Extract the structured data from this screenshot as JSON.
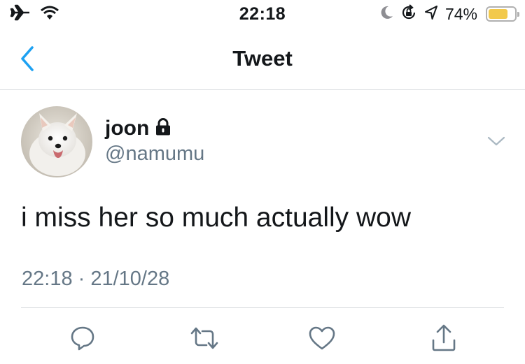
{
  "status_bar": {
    "time": "22:18",
    "battery_percent_label": "74%",
    "battery_level": 0.74,
    "icons": [
      "airplane-mode-icon",
      "wifi-icon",
      "do-not-disturb-moon-icon",
      "orientation-lock-icon",
      "location-arrow-icon",
      "battery-icon"
    ],
    "battery_fill_color": "#f2c94c"
  },
  "nav": {
    "title": "Tweet",
    "back_icon": "chevron-left-icon",
    "accent_color": "#1da1f2"
  },
  "tweet": {
    "author_name": "joon",
    "protected_icon": "lock-icon",
    "handle": "@namumu",
    "text": "i miss her so much actually wow",
    "timestamp": "22:18 · 21/10/28",
    "menu_icon": "chevron-down-icon"
  },
  "actions": [
    {
      "name": "reply",
      "icon": "reply-icon"
    },
    {
      "name": "retweet",
      "icon": "retweet-icon"
    },
    {
      "name": "like",
      "icon": "heart-icon"
    },
    {
      "name": "share",
      "icon": "share-icon"
    }
  ],
  "colors": {
    "text_primary": "#14171a",
    "text_secondary": "#657786",
    "divider": "#d7dbde",
    "icon_gray": "#657786"
  }
}
